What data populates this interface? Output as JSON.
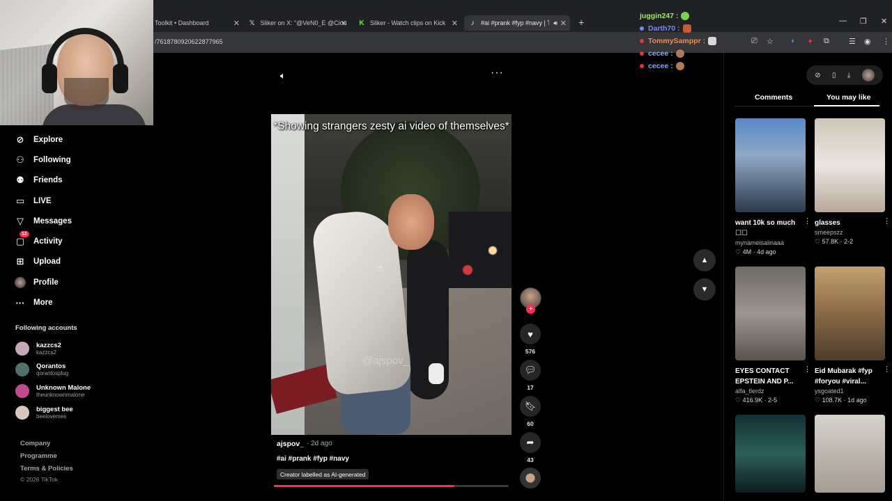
{
  "browser": {
    "tabs": [
      {
        "label": "Toolkit • Dashboard",
        "icon": "dashboard-icon"
      },
      {
        "label": "Sliker on X: \"@VeN0_E @Cinna",
        "icon": "x-logo-icon"
      },
      {
        "label": "Sliker - Watch clips on Kick",
        "icon": "kick-logo-icon"
      },
      {
        "label": "#ai #prank #fyp #navy | Tik",
        "icon": "tiktok-logo-icon"
      }
    ],
    "url": "/7618780920622877965"
  },
  "chat": [
    {
      "user": "juggin247",
      "color": "#9ef05a",
      "emote_color": "#7cd34a"
    },
    {
      "user": "Darth70",
      "color": "#6f8cff",
      "emote_color": "#c75a3a"
    },
    {
      "user": "TommySamppr",
      "color": "#ff8a3d",
      "emote_color": "#d9d9d9"
    },
    {
      "user": "cecee",
      "color": "#8fa6ff",
      "emote_color": "#b07a5a"
    },
    {
      "user": "cecee",
      "color": "#8fa6ff",
      "emote_color": "#b07a5a"
    }
  ],
  "nav": {
    "items": [
      {
        "label": "Explore",
        "icon": "compass-icon"
      },
      {
        "label": "Following",
        "icon": "following-icon"
      },
      {
        "label": "Friends",
        "icon": "friends-icon"
      },
      {
        "label": "LIVE",
        "icon": "live-tv-icon"
      },
      {
        "label": "Messages",
        "icon": "messages-icon"
      },
      {
        "label": "Activity",
        "icon": "activity-icon",
        "badge": "12"
      },
      {
        "label": "Upload",
        "icon": "upload-icon"
      },
      {
        "label": "Profile",
        "icon": "profile-avatar-icon"
      },
      {
        "label": "More",
        "icon": "more-icon"
      }
    ],
    "following_title": "Following accounts",
    "accounts": [
      {
        "name": "kazzcs2",
        "handle": "kazzcs2",
        "color": "#c7a6b9"
      },
      {
        "name": "Qorantos",
        "handle": "qorantosplug",
        "color": "#4f6f6a"
      },
      {
        "name": "Unknown Malone",
        "handle": "theunknownmalone",
        "color": "#c04a8f"
      },
      {
        "name": "biggest bee",
        "handle": "beelovemes",
        "color": "#d8c7bf"
      }
    ],
    "footer": [
      "Company",
      "Programme",
      "Terms & Policies"
    ],
    "copyright": "© 2026 TikTok"
  },
  "video": {
    "caption": "*Showing strangers zesty ai video of themselves*",
    "watermark": "@ajspov_",
    "author": "ajspov_",
    "age": "· 2d ago",
    "tags": "#ai #prank #fyp #navy",
    "ai_label": "Creator labelled as AI-generated",
    "progress": 0.77,
    "accent": "#fe2c55"
  },
  "actions": {
    "likes": "576",
    "comments": "17",
    "saves": "60",
    "shares": "43"
  },
  "right": {
    "tabs": [
      "Comments",
      "You may like"
    ],
    "active_tab": "You may like",
    "cards": [
      {
        "title": "want 10k so much ☐☐",
        "user": "mynameisalinaaa",
        "stats": "♡ 4M · 4d ago",
        "bg": "linear-gradient(180deg,#5a88c9 0%,#8fa8c7 40%,#2f3a4a 100%)"
      },
      {
        "title": "glasses",
        "user": "smeepszz",
        "stats": "♡ 57.8K · 2-2",
        "bg": "linear-gradient(180deg,#cfc6ba 0%,#eae6df 50%,#b8a89a 100%)"
      },
      {
        "title": "EYES CONTACT EPSTEIN AND P...",
        "user": "alfa_tlerdz",
        "stats": "♡ 416.9K · 2-5",
        "bg": "linear-gradient(180deg,#6e6a66 0%,#9d958e 50%,#5a5350 100%)"
      },
      {
        "title": "Eid Mubarak #fyp #foryou #viral...",
        "user": "ysgoated1",
        "stats": "♡ 108.7K · 1d ago",
        "bg": "linear-gradient(180deg,#c3a070 0%,#8a6a45 50%,#4d3b2c 100%)"
      },
      {
        "title": "",
        "user": "",
        "stats": "",
        "bg": "linear-gradient(180deg,#123033 0%,#2c5f5a 50%,#0e1c1e 100%)"
      },
      {
        "title": "",
        "user": "",
        "stats": "",
        "bg": "linear-gradient(180deg,#d6d2cc 0%,#bdb6ad 50%,#a59c92 100%)"
      }
    ]
  }
}
